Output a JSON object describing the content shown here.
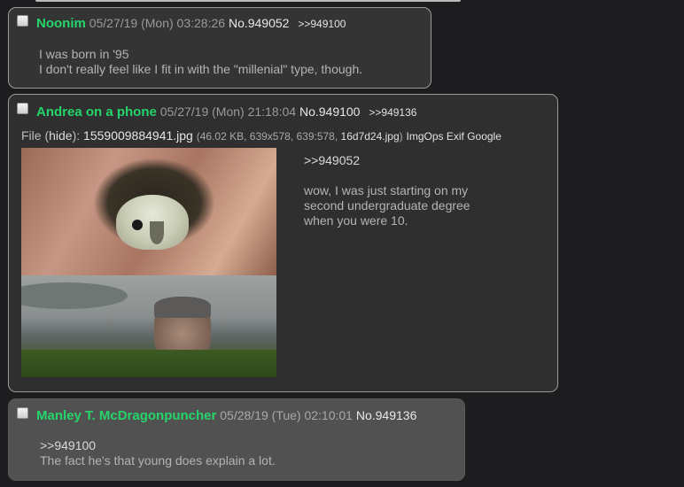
{
  "posts": [
    {
      "name": "Noonim",
      "date": "05/27/19 (Mon) 03:28:26",
      "number": "No.949052",
      "replies": [
        ">>949100"
      ],
      "lines": [
        "I was born in '95",
        "I don't really feel like I fit in with the \"millenial\" type, though."
      ]
    },
    {
      "name": "Andrea on a phone",
      "date": "05/27/19 (Mon) 21:18:04",
      "number": "No.949100",
      "replies": [
        ">>949136"
      ],
      "file": {
        "label": "File (",
        "hide": "hide",
        "label_end": "):",
        "filename": "1559009884941.jpg",
        "meta_start": "(46.02 KB, 639x578, 639:578,",
        "original": "16d7d24.jpg",
        "meta_end": ")",
        "tools": "ImgOps Exif Google"
      },
      "quote": ">>949052",
      "lines": [
        "wow, I was just starting on my",
        "second undergraduate degree",
        "when you were 10."
      ]
    },
    {
      "name": "Manley T. McDragonpuncher",
      "date": "05/28/19 (Tue) 02:10:01",
      "number": "No.949136",
      "quote": ">>949100",
      "lines": [
        "The fact he's that young does explain a lot."
      ]
    }
  ]
}
